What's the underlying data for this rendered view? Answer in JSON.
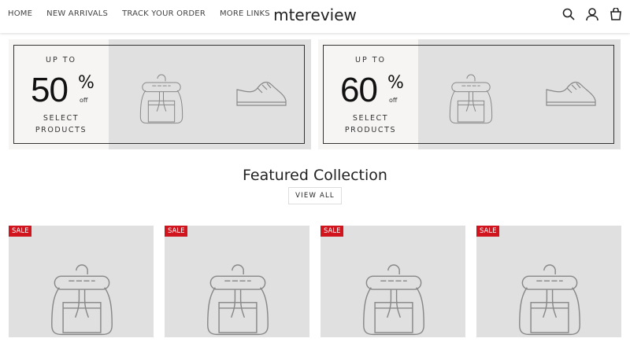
{
  "header": {
    "nav": [
      "HOME",
      "NEW ARRIVALS",
      "TRACK YOUR ORDER",
      "MORE LINKS"
    ],
    "logo": "mtereview",
    "icons": [
      "search-icon",
      "account-icon",
      "cart-icon"
    ]
  },
  "banners": [
    {
      "up_to": "UP TO",
      "percent": "50",
      "percent_sign": "%",
      "off": "off",
      "line1": "SELECT",
      "line2": "PRODUCTS"
    },
    {
      "up_to": "UP TO",
      "percent": "60",
      "percent_sign": "%",
      "off": "off",
      "line1": "SELECT",
      "line2": "PRODUCTS"
    }
  ],
  "featured": {
    "title": "Featured Collection",
    "view_all": "VIEW ALL"
  },
  "products": [
    {
      "badge": "SALE"
    },
    {
      "badge": "SALE"
    },
    {
      "badge": "SALE"
    },
    {
      "badge": "SALE"
    }
  ],
  "colors": {
    "sale": "#d0151f",
    "image_bg": "#e0e0e0"
  }
}
